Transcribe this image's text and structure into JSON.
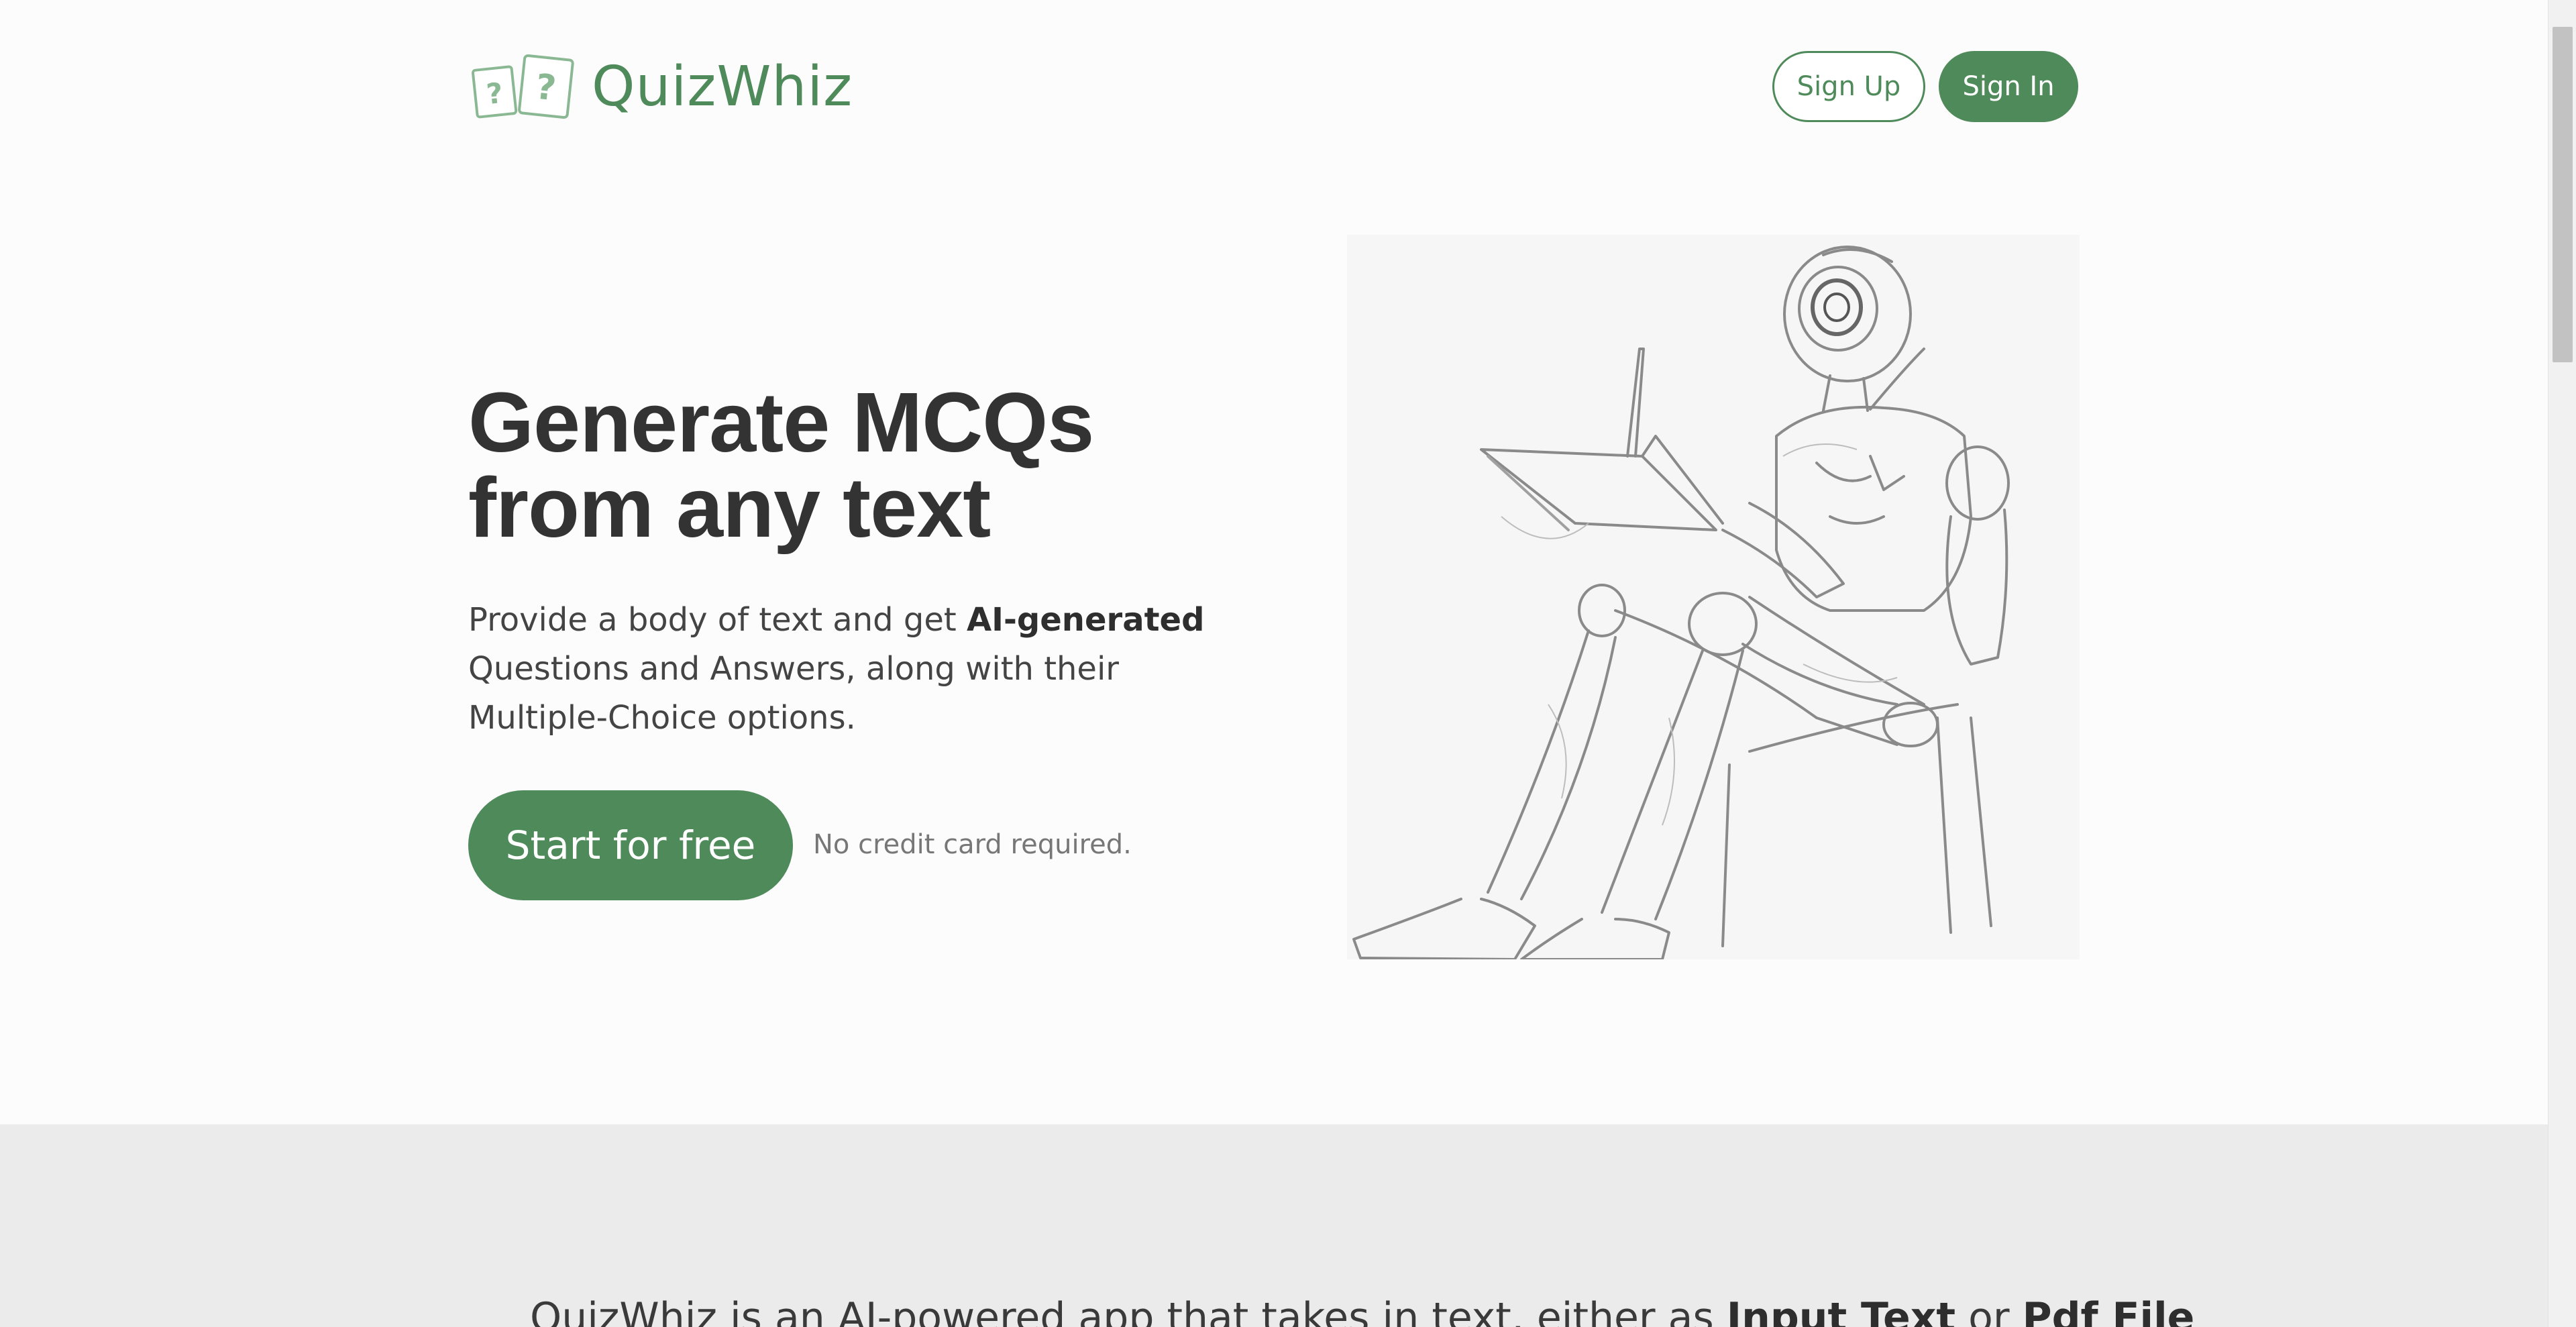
{
  "header": {
    "logo_text": "QuizWhiz",
    "logo_icon": "question-cards-icon",
    "signup_label": "Sign Up",
    "signin_label": "Sign In"
  },
  "hero": {
    "title_line1": "Generate MCQs",
    "title_line2": "from any text",
    "desc_part1": "Provide a body of text and get ",
    "desc_bold": "AI-generated",
    "desc_part2": "Questions and Answers, along with their Multiple-Choice options.",
    "cta_label": "Start for free",
    "cta_note": "No credit card required.",
    "image_icon": "robot-reading-sketch"
  },
  "intro": {
    "part1": "QuizWhiz is an AI-powered app that takes in text, either as ",
    "bold1": "Input Text",
    "part2": " or ",
    "bold2": "Pdf File"
  },
  "colors": {
    "accent": "#4f8a5a",
    "background": "#fcfcfc",
    "section_background": "#ebebeb",
    "heading_text": "#333333"
  }
}
